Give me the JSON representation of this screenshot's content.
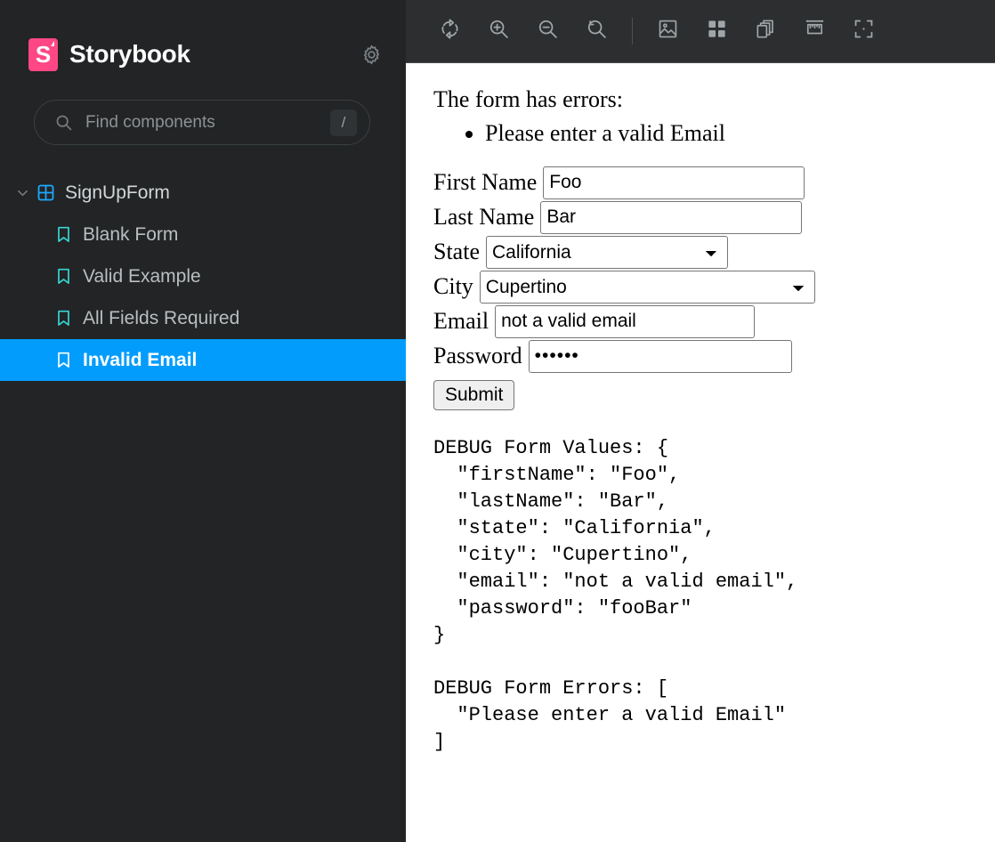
{
  "sidebar": {
    "brand": {
      "name": "Storybook",
      "logo_letter": "S",
      "logo_color": "#FF4785"
    },
    "settings_icon": "gear-icon",
    "search": {
      "placeholder": "Find components",
      "value": "",
      "shortcut": "/"
    },
    "tree": {
      "component": {
        "label": "SignUpForm",
        "expanded": true,
        "icon_color": "#1EA7FD"
      },
      "stories": [
        {
          "label": "Blank Form",
          "selected": false
        },
        {
          "label": "Valid Example",
          "selected": false
        },
        {
          "label": "All Fields Required",
          "selected": false
        },
        {
          "label": "Invalid Email",
          "selected": true
        }
      ]
    },
    "selected_color": "#029CFD",
    "background": "#222425"
  },
  "toolbar": {
    "background": "#2C2E30",
    "items": [
      {
        "name": "remount-button",
        "icon": "refresh-icon",
        "title": "Remount component"
      },
      {
        "name": "zoom-in-button",
        "icon": "zoom-in-icon",
        "title": "Zoom in"
      },
      {
        "name": "zoom-out-button",
        "icon": "zoom-out-icon",
        "title": "Zoom out"
      },
      {
        "name": "zoom-reset-button",
        "icon": "zoom-reset-icon",
        "title": "Reset zoom"
      },
      {
        "name": "backgrounds-button",
        "icon": "image-icon",
        "title": "Change background"
      },
      {
        "name": "grid-button",
        "icon": "grid-icon",
        "title": "Apply grid"
      },
      {
        "name": "viewport-button",
        "icon": "layers-icon",
        "title": "Change viewport"
      },
      {
        "name": "measure-button",
        "icon": "ruler-icon",
        "title": "Measure"
      },
      {
        "name": "outline-button",
        "icon": "outline-icon",
        "title": "Outline"
      }
    ]
  },
  "canvas": {
    "errors_heading": "The form has errors:",
    "errors": [
      "Please enter a valid Email"
    ],
    "fields": [
      {
        "label": "First Name",
        "type": "text",
        "value": "Foo",
        "name": "first-name"
      },
      {
        "label": "Last Name",
        "type": "text",
        "value": "Bar",
        "name": "last-name"
      },
      {
        "label": "State",
        "type": "select",
        "value": "California",
        "name": "state"
      },
      {
        "label": "City",
        "type": "select",
        "value": "Cupertino",
        "name": "city"
      },
      {
        "label": "Email",
        "type": "text",
        "value": "not a valid email",
        "name": "email"
      },
      {
        "label": "Password",
        "type": "password",
        "value": "••••••",
        "name": "password"
      }
    ],
    "submit_label": "Submit",
    "debug_values": "DEBUG Form Values: {\n  \"firstName\": \"Foo\",\n  \"lastName\": \"Bar\",\n  \"state\": \"California\",\n  \"city\": \"Cupertino\",\n  \"email\": \"not a valid email\",\n  \"password\": \"fooBar\"\n}",
    "debug_errors": "DEBUG Form Errors: [\n  \"Please enter a valid Email\"\n]"
  }
}
